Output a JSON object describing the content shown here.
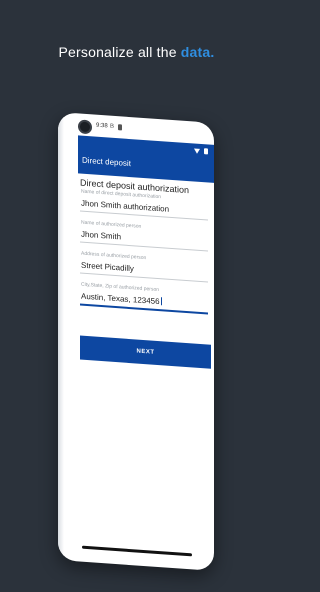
{
  "promo": {
    "text": "Personalize all the",
    "highlight": "data."
  },
  "status_bar": {
    "time": "9:38",
    "icon_b": "B"
  },
  "app_bar": {
    "title": "Direct deposit"
  },
  "form": {
    "heading": "Direct deposit authorization",
    "fields": [
      {
        "label": "Name of direct deposit authorization",
        "value": "Jhon Smith authorization"
      },
      {
        "label": "Name of authorized person",
        "value": "Jhon Smith"
      },
      {
        "label": "Address of authorized person",
        "value": "Street Picadilly"
      },
      {
        "label": "City,State, Zip of authorized person",
        "value": "Austin, Texas, 123456"
      }
    ],
    "next_label": "NEXT"
  },
  "colors": {
    "background": "#2b323b",
    "accent": "#0d47a1",
    "highlight": "#2f8ee0"
  }
}
